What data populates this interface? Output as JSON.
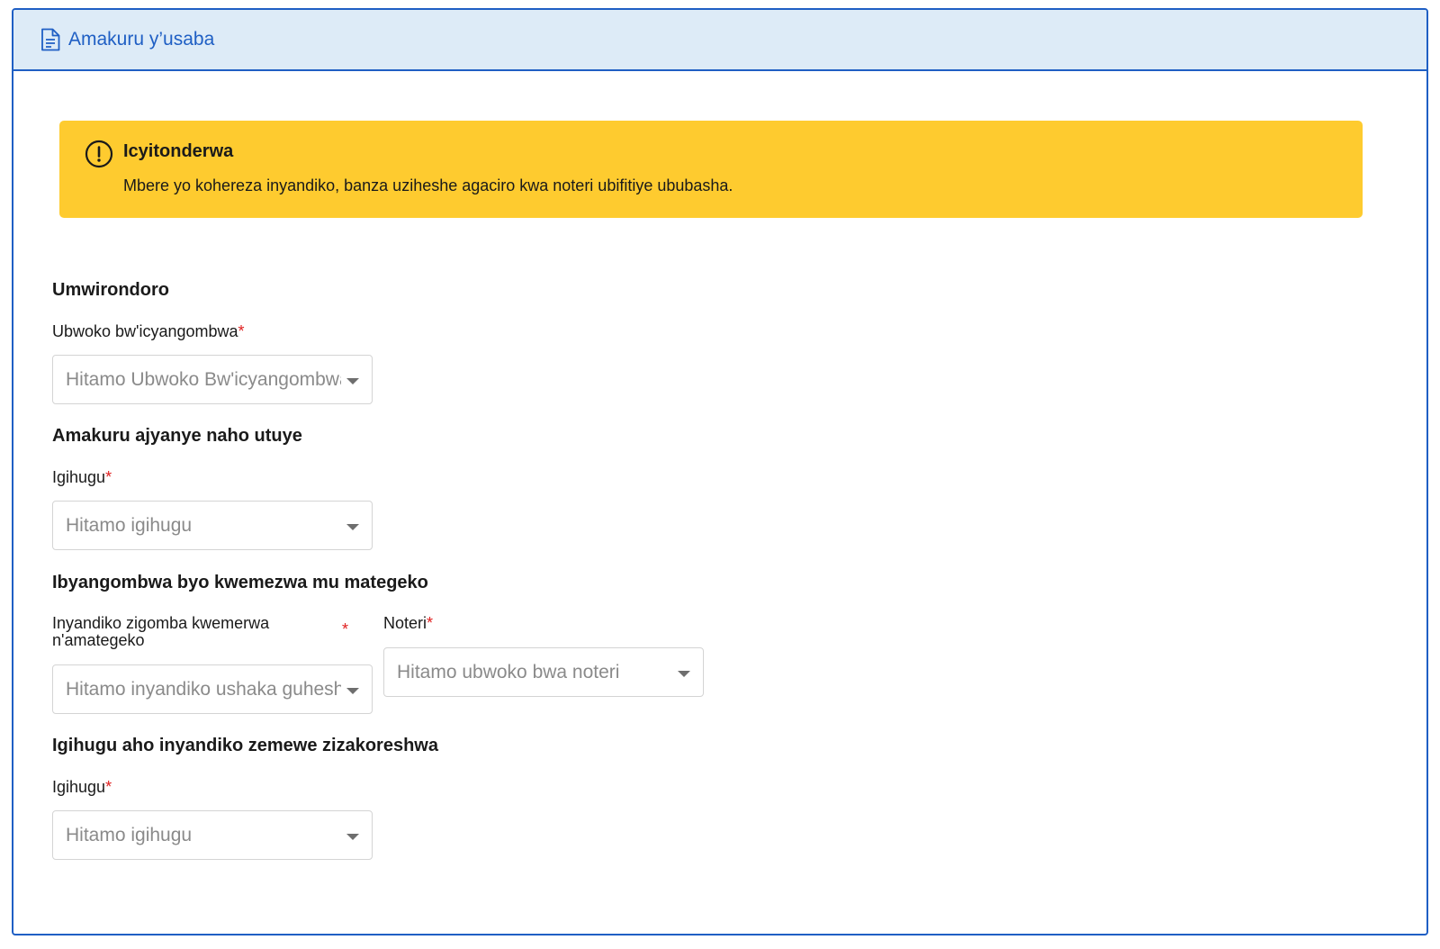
{
  "header": {
    "title": "Amakuru y’usaba",
    "icon": "document-icon"
  },
  "alert": {
    "icon": "exclamation-circle-icon",
    "title": "Icyitonderwa",
    "text": "Mbere yo kohereza inyandiko, banza uziheshe agaciro kwa noteri ubifitiye ububasha."
  },
  "sections": {
    "profile": {
      "heading": "Umwirondoro",
      "doc_type_label": "Ubwoko bw'icyangombwa",
      "doc_type_placeholder": "Hitamo Ubwoko Bw'icyangombwa"
    },
    "residence": {
      "heading": "Amakuru ajyanye naho utuye",
      "country_label": "Igihugu",
      "country_placeholder": "Hitamo igihugu"
    },
    "legalization": {
      "heading": "Ibyangombwa byo kwemezwa mu mategeko",
      "docs_label": "Inyandiko zigomba kwemerwa n'amategeko",
      "docs_placeholder": "Hitamo inyandiko ushaka guhesha agaciro",
      "notary_label": "Noteri",
      "notary_placeholder": "Hitamo ubwoko bwa noteri"
    },
    "usage_country": {
      "heading": "Igihugu aho inyandiko zemewe zizakoreshwa",
      "country_label": "Igihugu",
      "country_placeholder": "Hitamo igihugu"
    }
  },
  "required_marker": "*",
  "colors": {
    "accent": "#1f5fc4",
    "header_bg": "#ddebf7",
    "alert_bg": "#fecb2f",
    "required": "#e02020",
    "placeholder": "#8a8a8a"
  }
}
